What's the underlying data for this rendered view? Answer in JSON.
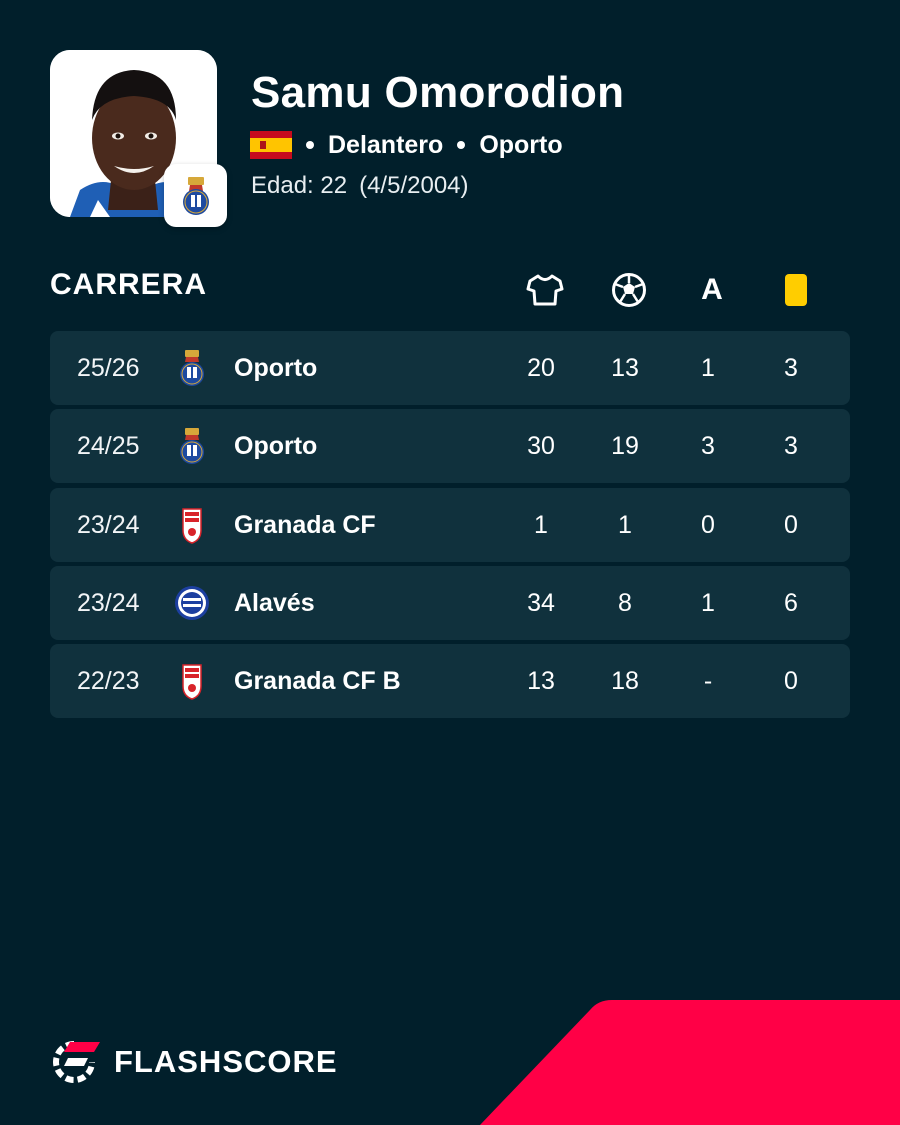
{
  "player": {
    "name": "Samu Omorodion",
    "position": "Delantero",
    "club": "Oporto",
    "age_label": "Edad: 22",
    "birthdate": "(4/5/2004)",
    "flag": "spain-flag-icon"
  },
  "career": {
    "title": "CARRERA",
    "columns": [
      "jersey-icon",
      "ball-icon",
      "assist-icon",
      "yellow-card-icon"
    ],
    "assist_header": "A",
    "rows": [
      {
        "season": "25/26",
        "team": "Oporto",
        "logo": "porto-crest-icon",
        "matches": "20",
        "goals": "13",
        "assists": "1",
        "yellow": "3"
      },
      {
        "season": "24/25",
        "team": "Oporto",
        "logo": "porto-crest-icon",
        "matches": "30",
        "goals": "19",
        "assists": "3",
        "yellow": "3"
      },
      {
        "season": "23/24",
        "team": "Granada CF",
        "logo": "granada-crest-icon",
        "matches": "1",
        "goals": "1",
        "assists": "0",
        "yellow": "0"
      },
      {
        "season": "23/24",
        "team": "Alavés",
        "logo": "alaves-crest-icon",
        "matches": "34",
        "goals": "8",
        "assists": "1",
        "yellow": "6"
      },
      {
        "season": "22/23",
        "team": "Granada CF B",
        "logo": "granada-crest-icon",
        "matches": "13",
        "goals": "18",
        "assists": "-",
        "yellow": "0"
      }
    ]
  },
  "brand": {
    "name": "FLASHSCORE"
  },
  "colors": {
    "background": "#011f2b",
    "row": "#10313d",
    "accent": "#ff0046",
    "card": "#ffcd00"
  }
}
